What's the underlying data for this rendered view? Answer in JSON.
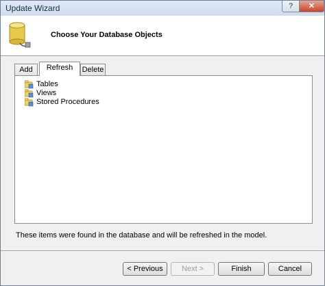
{
  "window": {
    "title": "Update Wizard",
    "help_label": "?",
    "close_label": "✕"
  },
  "header": {
    "heading": "Choose Your Database Objects",
    "icon": "database-icon"
  },
  "tabs": [
    {
      "label": "Add",
      "active": false
    },
    {
      "label": "Refresh",
      "active": true
    },
    {
      "label": "Delete",
      "active": false
    }
  ],
  "tree": {
    "items": [
      {
        "label": "Tables",
        "icon": "folder-db-icon"
      },
      {
        "label": "Views",
        "icon": "folder-db-icon"
      },
      {
        "label": "Stored Procedures",
        "icon": "folder-db-icon"
      }
    ]
  },
  "info_text": "These items were found in the database and will be refreshed in the model.",
  "buttons": {
    "previous": "< Previous",
    "next": "Next >",
    "finish": "Finish",
    "cancel": "Cancel"
  },
  "colors": {
    "close": "#c9442a",
    "database": "#e8c94a"
  }
}
